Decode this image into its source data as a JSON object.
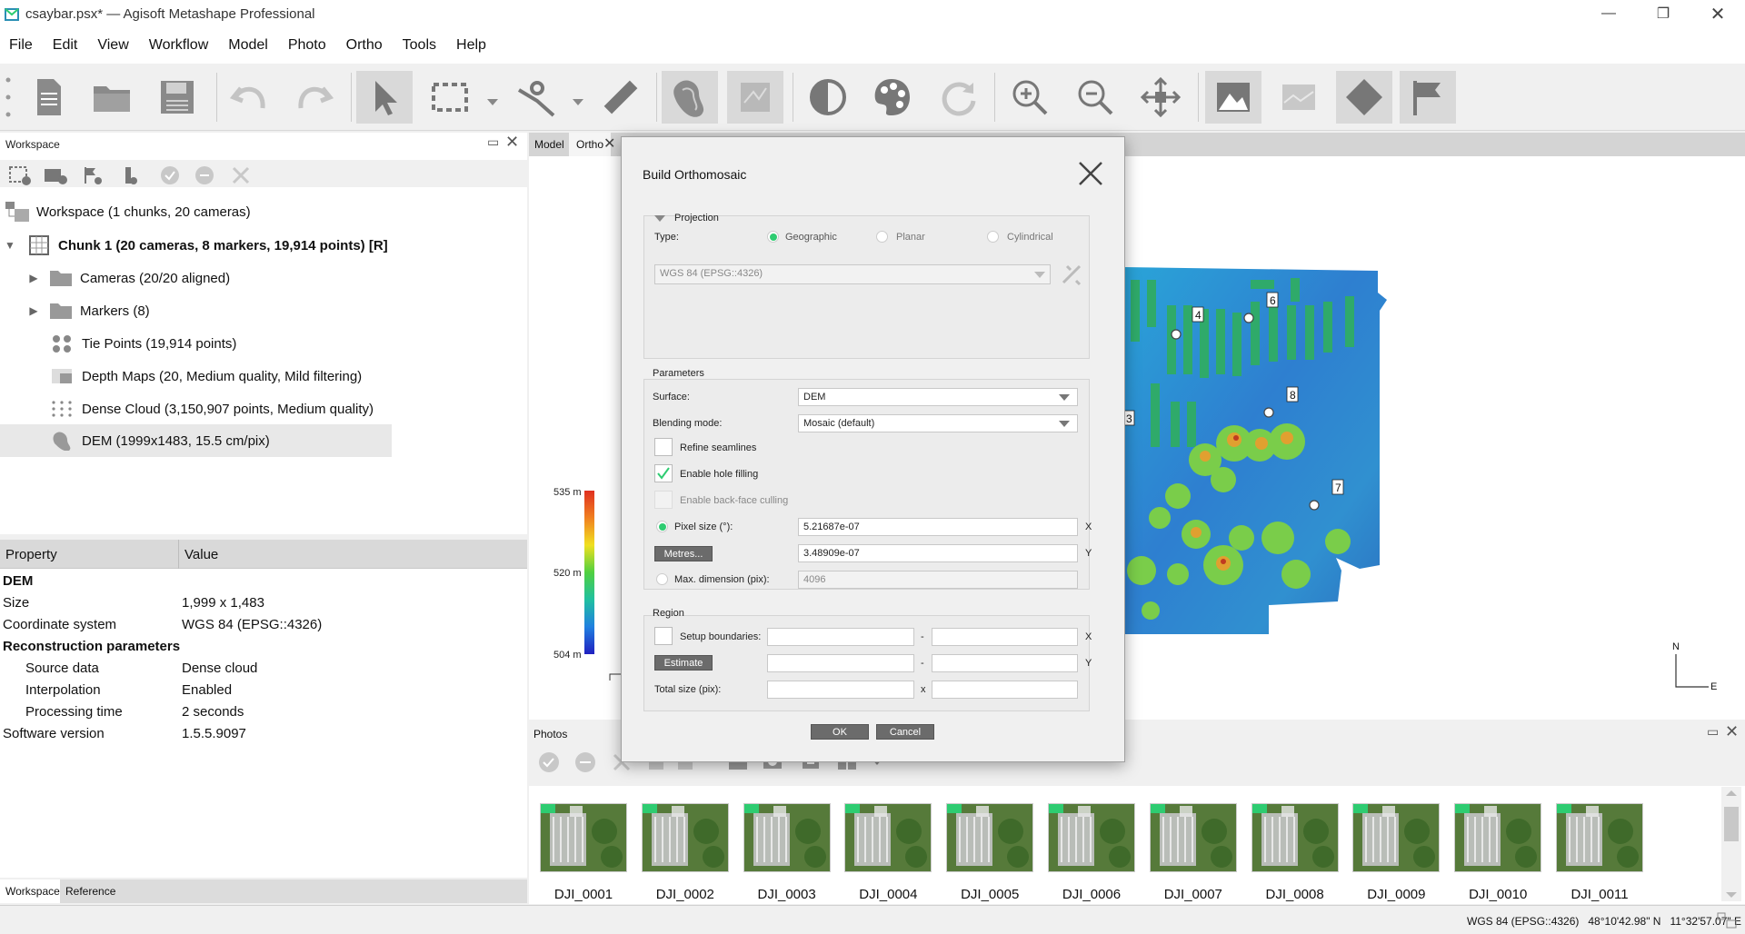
{
  "window": {
    "title": "csaybar.psx* — Agisoft Metashape Professional"
  },
  "menu": [
    "File",
    "Edit",
    "View",
    "Workflow",
    "Model",
    "Photo",
    "Ortho",
    "Tools",
    "Help"
  ],
  "workspace": {
    "title": "Workspace",
    "root": "Workspace (1 chunks, 20 cameras)",
    "chunk": "Chunk 1 (20 cameras, 8 markers, 19,914 points) [R]",
    "items": [
      {
        "label": "Cameras (20/20 aligned)",
        "icon": "folder-icon"
      },
      {
        "label": "Markers (8)",
        "icon": "folder-icon"
      },
      {
        "label": "Tie Points (19,914 points)",
        "icon": "tie-points-icon"
      },
      {
        "label": "Depth Maps (20, Medium quality, Mild filtering)",
        "icon": "depth-maps-icon"
      },
      {
        "label": "Dense Cloud (3,150,907 points, Medium quality)",
        "icon": "dense-cloud-icon"
      },
      {
        "label": "DEM (1999x1483, 15.5 cm/pix)",
        "icon": "dem-icon"
      }
    ]
  },
  "properties": {
    "col_property": "Property",
    "col_value": "Value",
    "rows": [
      {
        "k": "DEM",
        "v": "",
        "bold": true
      },
      {
        "k": "Size",
        "v": "1,999 x 1,483"
      },
      {
        "k": "Coordinate system",
        "v": "WGS 84 (EPSG::4326)"
      },
      {
        "k": "Reconstruction parameters",
        "v": "",
        "bold": true
      },
      {
        "k": "Source data",
        "v": "Dense cloud",
        "indent": true
      },
      {
        "k": "Interpolation",
        "v": "Enabled",
        "indent": true
      },
      {
        "k": "Processing time",
        "v": "2 seconds",
        "indent": true
      },
      {
        "k": "Software version",
        "v": "1.5.5.9097"
      }
    ]
  },
  "bottom_tabs": [
    "Workspace",
    "Reference"
  ],
  "view": {
    "tabs": [
      "Model",
      "Ortho"
    ],
    "legend": {
      "max": "535 m",
      "mid": "520 m",
      "min": "504 m"
    },
    "markers": [
      "3",
      "4",
      "6",
      "7",
      "8"
    ],
    "compass": {
      "n": "N",
      "e": "E"
    }
  },
  "photos": {
    "title": "Photos",
    "names": [
      "DJI_0001",
      "DJI_0002",
      "DJI_0003",
      "DJI_0004",
      "DJI_0005",
      "DJI_0006",
      "DJI_0007",
      "DJI_0008",
      "DJI_0009",
      "DJI_0010",
      "DJI_0011"
    ]
  },
  "status": {
    "text": "WGS 84 (EPSG::4326)   48°10'42.98\" N   11°32'57.07\" E"
  },
  "dialog": {
    "title": "Build Orthomosaic",
    "projection": {
      "label": "Projection",
      "type_label": "Type:",
      "options": [
        "Geographic",
        "Planar",
        "Cylindrical"
      ],
      "selected": "Geographic",
      "crs": "WGS 84 (EPSG::4326)"
    },
    "parameters": {
      "label": "Parameters",
      "surface_label": "Surface:",
      "surface": "DEM",
      "blending_label": "Blending mode:",
      "blending": "Mosaic (default)",
      "refine": "Refine seamlines",
      "hole": "Enable hole filling",
      "backface": "Enable back-face culling",
      "pixel_label": "Pixel size (°):",
      "pixel_x": "5.21687e-07",
      "pixel_y": "3.48909e-07",
      "metres": "Metres...",
      "maxdim_label": "Max. dimension (pix):",
      "maxdim": "4096",
      "x": "X",
      "y": "Y"
    },
    "region": {
      "label": "Region",
      "setup": "Setup boundaries:",
      "estimate": "Estimate",
      "total": "Total size (pix):",
      "dash": "-",
      "x": "X",
      "y": "Y",
      "times": "x"
    },
    "ok": "OK",
    "cancel": "Cancel"
  },
  "colors": {
    "accent": "#2ecc71",
    "selected_row": "#e8e8e8"
  }
}
